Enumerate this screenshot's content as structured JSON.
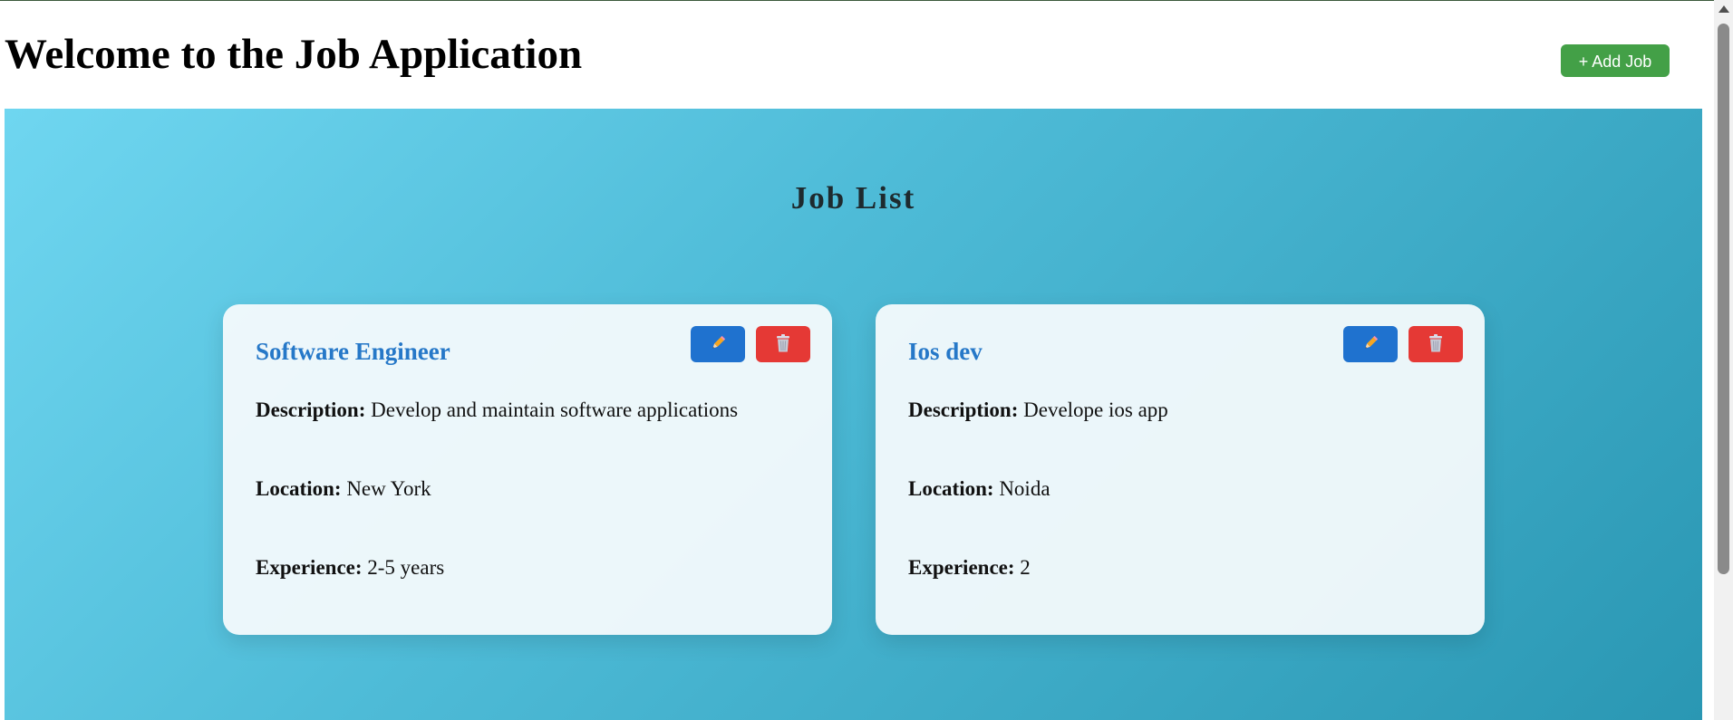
{
  "header": {
    "title": "Welcome to the Job Application",
    "add_button_label": "+ Add Job"
  },
  "main": {
    "section_title": "Job List",
    "field_labels": {
      "description": "Description:",
      "location": "Location:",
      "experience": "Experience:"
    },
    "jobs": [
      {
        "title": "Software Engineer",
        "description": "Develop and maintain software applications",
        "location": "New York",
        "experience": "2-5 years"
      },
      {
        "title": "Ios dev",
        "description": "Develope ios app",
        "location": "Noida",
        "experience": "2"
      }
    ]
  },
  "icons": {
    "edit": "pencil-icon",
    "delete": "trash-icon"
  },
  "colors": {
    "add_button": "#43a047",
    "edit_button": "#1f72cf",
    "delete_button": "#e53935",
    "job_title": "#2678c8",
    "panel_gradient_start": "#6fd6f0",
    "panel_gradient_end": "#2a97b3"
  }
}
